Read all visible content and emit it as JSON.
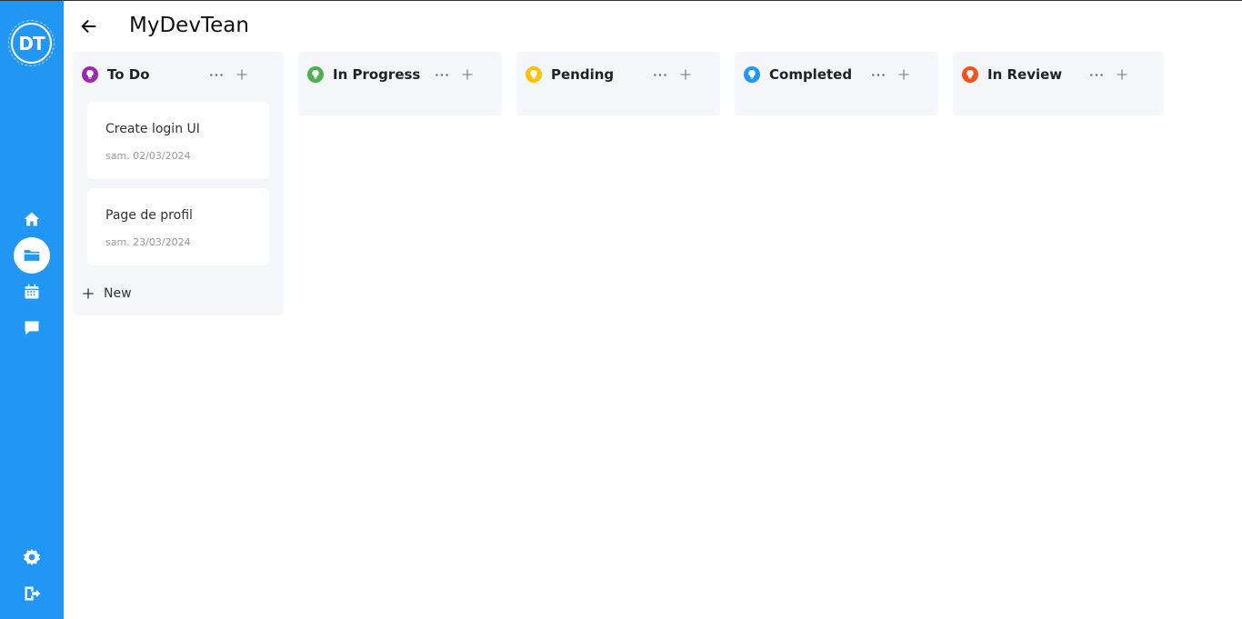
{
  "app": {
    "logo_text": "DT",
    "title": "MyDevTean"
  },
  "sidebar": {
    "items": [
      {
        "icon": "home-icon"
      },
      {
        "icon": "folder-icon",
        "active": true
      },
      {
        "icon": "calendar-icon"
      },
      {
        "icon": "chat-icon"
      }
    ],
    "bottom": [
      {
        "icon": "gear-icon"
      },
      {
        "icon": "logout-icon"
      }
    ]
  },
  "columns": [
    {
      "title": "To Do",
      "color": "#9c27b0",
      "cards": [
        {
          "title": "Create login UI",
          "date": "sam. 02/03/2024"
        },
        {
          "title": "Page de profil",
          "date": "sam. 23/03/2024"
        }
      ],
      "new_label": "New"
    },
    {
      "title": "In Progress",
      "color": "#4caf50"
    },
    {
      "title": "Pending",
      "color": "#ffc107"
    },
    {
      "title": "Completed",
      "color": "#2196f3"
    },
    {
      "title": "In Review",
      "color": "#f4511e"
    }
  ],
  "colors": {
    "sidebar": "#2196f3",
    "column_bg": "#f4f6fa"
  }
}
